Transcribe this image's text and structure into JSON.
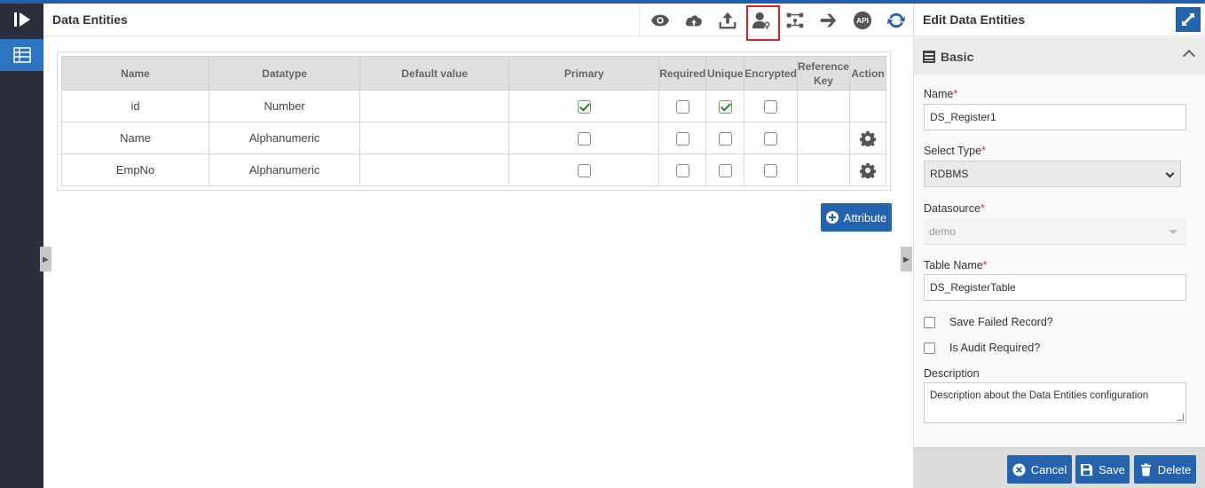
{
  "main": {
    "title": "Data Entities",
    "toolbar": [
      {
        "name": "preview",
        "icon": "eye-icon"
      },
      {
        "name": "cloud",
        "icon": "cloud-icon"
      },
      {
        "name": "upload",
        "icon": "upload-icon"
      },
      {
        "name": "user-settings",
        "icon": "user-key-icon"
      },
      {
        "name": "relations",
        "icon": "relation-icon"
      },
      {
        "name": "forward",
        "icon": "arrow-right-icon"
      },
      {
        "name": "api",
        "icon": "api-icon",
        "label": "API"
      },
      {
        "name": "refresh",
        "icon": "refresh-icon"
      }
    ]
  },
  "table": {
    "headers": {
      "name": "Name",
      "datatype": "Datatype",
      "default": "Default value",
      "primary": "Primary",
      "required": "Required",
      "unique": "Unique",
      "encrypted": "Encrypted",
      "refkey_1": "Reference",
      "refkey_2": "Key",
      "action": "Action"
    },
    "rows": [
      {
        "name": "id",
        "datatype": "Number",
        "default": "",
        "primary": true,
        "required": false,
        "unique": true,
        "encrypted": false,
        "has_action": false
      },
      {
        "name": "Name",
        "datatype": "Alphanumeric",
        "default": "",
        "primary": false,
        "required": false,
        "unique": false,
        "encrypted": false,
        "has_action": true
      },
      {
        "name": "EmpNo",
        "datatype": "Alphanumeric",
        "default": "",
        "primary": false,
        "required": false,
        "unique": false,
        "encrypted": false,
        "has_action": true
      }
    ]
  },
  "attribute_button": "Attribute",
  "right": {
    "title": "Edit Data Entities",
    "section": "Basic",
    "name_label": "Name",
    "name_value": "DS_Register1",
    "type_label": "Select Type",
    "type_value": "RDBMS",
    "datasource_label": "Datasource",
    "datasource_value": "demo",
    "table_label": "Table Name",
    "table_value": "DS_RegisterTable",
    "save_failed_label": "Save Failed Record?",
    "audit_label": "Is Audit Required?",
    "description_label": "Description",
    "description_value": "Description about the Data Entities configuration",
    "required_mark": "*",
    "cancel_label": "Cancel",
    "save_label": "Save",
    "delete_label": "Delete"
  },
  "colors": {
    "accent": "#2563ad",
    "rail": "#2b2f3b",
    "highlight": "#e32020",
    "check": "#1a8a1a"
  }
}
